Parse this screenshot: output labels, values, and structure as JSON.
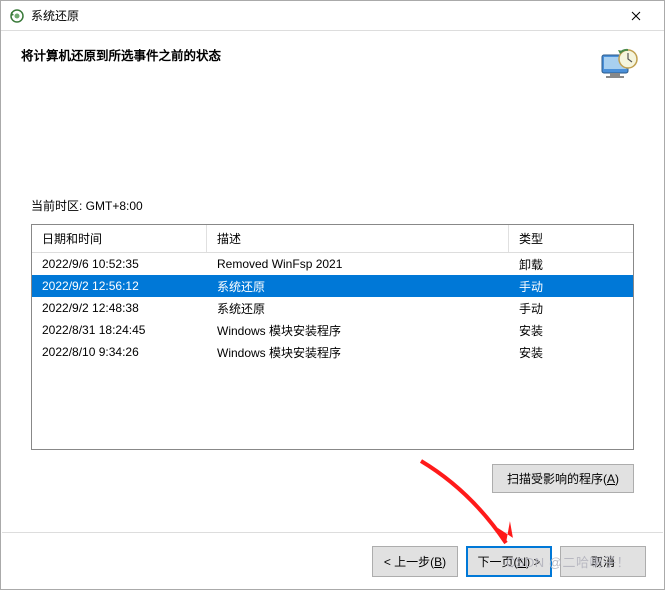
{
  "titlebar": {
    "title": "系统还原"
  },
  "header": {
    "text": "将计算机还原到所选事件之前的状态"
  },
  "timezone_label": "当前时区: GMT+8:00",
  "table": {
    "headers": {
      "date": "日期和时间",
      "desc": "描述",
      "type": "类型"
    },
    "rows": [
      {
        "date": "2022/9/6 10:52:35",
        "desc": "Removed WinFsp 2021",
        "type": "卸载",
        "selected": false
      },
      {
        "date": "2022/9/2 12:56:12",
        "desc": "系统还原",
        "type": "手动",
        "selected": true
      },
      {
        "date": "2022/9/2 12:48:38",
        "desc": "系统还原",
        "type": "手动",
        "selected": false
      },
      {
        "date": "2022/8/31 18:24:45",
        "desc": "Windows 模块安装程序",
        "type": "安装",
        "selected": false
      },
      {
        "date": "2022/8/10 9:34:26",
        "desc": "Windows 模块安装程序",
        "type": "安装",
        "selected": false
      }
    ]
  },
  "scan_button": "扫描受影响的程序(A)",
  "footer": {
    "back": "< 上一步(B)",
    "next": "下一页(N) >",
    "cancel": "取消"
  },
  "watermark": "CSDN @二哈喇子！"
}
